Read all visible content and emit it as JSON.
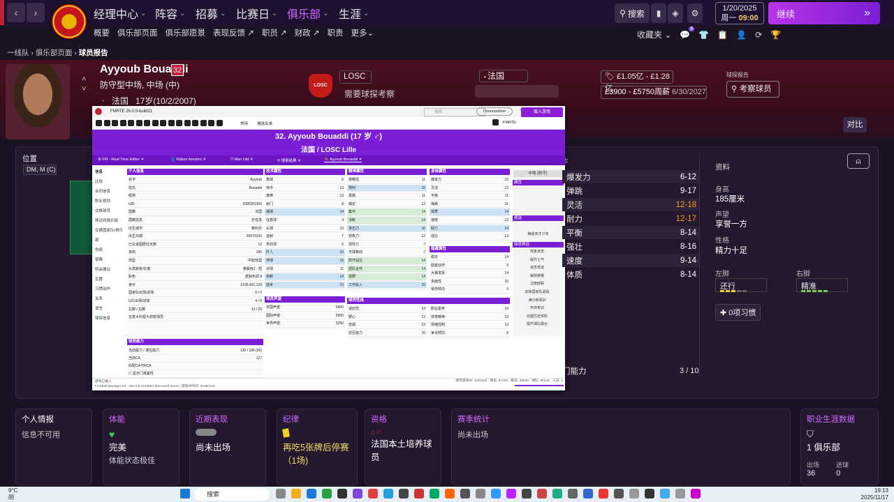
{
  "nav": {
    "main": [
      "经理中心",
      "阵容",
      "招募",
      "比赛日",
      "俱乐部",
      "生涯"
    ],
    "active_index": 4,
    "sub": [
      "概要",
      "俱乐部页面",
      "俱乐部愿景",
      "表现反馈",
      "职员",
      "财政",
      "职责",
      "更多"
    ],
    "search": "搜索",
    "date": "1/20/2025",
    "weekday": "周一",
    "time": "09:00",
    "continue": "继续",
    "favorites": "收藏夹",
    "badge_count": "5"
  },
  "breadcrumb": {
    "a": "一线队",
    "b": "俱乐部页面",
    "c": "球员报告"
  },
  "player": {
    "name": "Ayyoub Bouaddi",
    "number": "32",
    "position": "防守型中场, 中场 (中)",
    "nation": "法国",
    "age": "17岁(10/2/2007)",
    "club": "LOSC",
    "club_crest_text": "LOSC",
    "scout_needed": "需要球探考察",
    "nation2": "法国",
    "value": "£1.05亿 - £1.28亿",
    "wage": "£3900 - £5750周薪",
    "contract": "6/30/2027",
    "scout_report_label": "球探报告",
    "scout_button": "考察球员",
    "compare": "对比"
  },
  "panel": {
    "position_label": "位置",
    "position_value": "DM, M (C)",
    "attributes": [
      {
        "name": "爆发力",
        "value": "6-12",
        "color": "#ffffff"
      },
      {
        "name": "弹跳",
        "value": "9-17",
        "color": "#ffffff"
      },
      {
        "name": "灵活",
        "value": "12-18",
        "color": "#f4a020"
      },
      {
        "name": "耐力",
        "value": "12-17",
        "color": "#f4a020"
      },
      {
        "name": "平衡",
        "value": "8-14",
        "color": "#ffffff"
      },
      {
        "name": "强壮",
        "value": "8-16",
        "color": "#ffffff"
      },
      {
        "name": "速度",
        "value": "9-14",
        "color": "#ffffff"
      },
      {
        "name": "体质",
        "value": "8-14",
        "color": "#ffffff"
      }
    ],
    "gk_label": "门能力",
    "gk_value": "3 / 10",
    "info_title": "资料",
    "height_label": "身高",
    "height": "185厘米",
    "rep_label": "声望",
    "rep": "享誉一方",
    "personality_label": "性格",
    "personality": "精力十足",
    "left_foot_label": "左脚",
    "left_foot": "还行",
    "right_foot_label": "右脚",
    "right_foot": "精准",
    "habits": "0项习惯"
  },
  "cards": {
    "intel_title": "个人情报",
    "intel_text": "信息不可用",
    "fitness_title": "体能",
    "fitness_big": "完美",
    "fitness_sub": "体能状态极佳",
    "form_title": "近期表现",
    "form_big": "尚未出场",
    "discipline_title": "纪律",
    "discipline_big": "再吃5张牌后停赛（1场)",
    "qual_title": "资格",
    "qual_big": "法国本土培养球员",
    "season_title": "赛季统计",
    "season_big": "尚未出场",
    "career_title": "职业生涯数据",
    "career_big": "1 俱乐部",
    "apps_label": "出场",
    "apps": "36",
    "goals_label": "进球",
    "goals": "0"
  },
  "fmrte": {
    "title": "FMRTE 26.0.5-build21",
    "user": "Oooooooliver",
    "search_ph": "搜索...",
    "brand": "FMRTE",
    "load": "载入游戏",
    "tb1": "常用",
    "tb2": "搜选名单",
    "header_name": "32. Ayyoub Bouaddi (17 岁 ♂)",
    "header_club": "法国 / LOSC Lille",
    "tabs": [
      "FM - Real Time Editor",
      "Rúben Amorim",
      "Man Utd",
      "搜索结果",
      "Ayyoub Bouaddi"
    ],
    "left_menu": [
      "信息",
      "比较",
      "合同信息",
      "职业规划",
      "交换球员",
      "移动到俱乐部",
      "交换国家队/俱乐部",
      "伤病",
      "禁赛",
      "转会建议",
      "位置",
      "习惯动作",
      "关系",
      "语言",
      "球探信息"
    ],
    "personal_title": "个人信息",
    "personal": [
      [
        "名字",
        "Ayyoub"
      ],
      [
        "姓氏",
        "Bouaddi"
      ],
      [
        "昵称",
        ""
      ],
      [
        "UID",
        "2000381365"
      ],
      [
        "国籍",
        "法国"
      ],
      [
        "国籍信息",
        "无信息"
      ],
      [
        "出生城市",
        "奥利尔"
      ],
      [
        "出生日期",
        "2007/10/2"
      ],
      [
        "已在该国居住天数",
        "12"
      ],
      [
        "身高",
        "185"
      ],
      [
        "体型",
        "中胚体型"
      ],
      [
        "头发颜色/长度",
        "卷曲色2 · 短"
      ],
      [
        "肤色",
        "皮肤色调 8"
      ],
      [
        "身价",
        "£105,491,128"
      ],
      [
        "国家队出场/进球",
        "0 / 0"
      ],
      [
        "U21出场/进球",
        "4 / 0"
      ],
      [
        "左脚 / 右脚",
        "10 / 20"
      ],
      [
        "在意大利视为非欧球员",
        ""
      ]
    ],
    "ability_title": "球员能力",
    "ability_rows": [
      [
        "当前能力 / 潜在能力",
        "130 / 186 (56)"
      ],
      [
        "当前CA",
        "127"
      ],
      [
        "匹配CA与RCA",
        ""
      ]
    ],
    "show_gk": "显示门将属性",
    "tech_title": "技术属性",
    "tech": [
      [
        "角球",
        "5"
      ],
      [
        "传中",
        "13"
      ],
      [
        "盘带",
        "13"
      ],
      [
        "射门",
        "8"
      ],
      [
        "接球",
        "14"
      ],
      [
        "任意球",
        "4"
      ],
      [
        "头球",
        "10"
      ],
      [
        "远射",
        "7"
      ],
      [
        "界外球",
        "6"
      ],
      [
        "盯人",
        "15"
      ],
      [
        "传球",
        "15"
      ],
      [
        "点球",
        "11"
      ],
      [
        "抢断",
        "14"
      ],
      [
        "技术",
        "15"
      ]
    ],
    "rep_title": "球员声望",
    "rep_rows": [
      [
        "本国声望",
        "6500"
      ],
      [
        "国际声望",
        "6500"
      ],
      [
        "世界声望",
        "5250"
      ]
    ],
    "mental_title": "精神属性",
    "mental": [
      [
        "侵略性",
        "11"
      ],
      [
        "预判",
        "15"
      ],
      [
        "勇敢",
        "11"
      ],
      [
        "镇定",
        "12"
      ],
      [
        "集中",
        "14"
      ],
      [
        "决断",
        "14"
      ],
      [
        "意志力",
        "16"
      ],
      [
        "想象力",
        "12"
      ],
      [
        "领导力",
        "7"
      ],
      [
        "无球跑动",
        "7"
      ],
      [
        "防守站位",
        "14"
      ],
      [
        "团队合作",
        "14"
      ],
      [
        "视野",
        "14"
      ],
      [
        "工作投入",
        "15"
      ]
    ],
    "pers_title": "球员性格",
    "pers": [
      [
        "适应性",
        "13"
      ],
      [
        "野心",
        "13"
      ],
      [
        "忠诚",
        "13"
      ],
      [
        "抗压能力",
        "16"
      ]
    ],
    "pers2": [
      [
        "职业素养",
        "15"
      ],
      [
        "体育精神",
        "13"
      ],
      [
        "情绪控制",
        "13"
      ],
      [
        "争论倾向",
        "8"
      ]
    ],
    "phys_title": "身体属性",
    "phys": [
      [
        "爆发力",
        "12"
      ],
      [
        "灵活",
        "12"
      ],
      [
        "平衡",
        "11"
      ],
      [
        "弹跳",
        "11"
      ],
      [
        "体质",
        "14"
      ],
      [
        "速度",
        "12"
      ],
      [
        "耐力",
        "14"
      ],
      [
        "强壮",
        "13"
      ]
    ],
    "hidden_title": "隐藏属性",
    "hidden": [
      [
        "稳定",
        "14"
      ],
      [
        "肮脏动作",
        "3"
      ],
      [
        "大赛发挥",
        "14"
      ],
      [
        "多面性",
        "10"
      ],
      [
        "受伤倾向",
        "3"
      ]
    ],
    "side_pos": "中场 (防守)",
    "side_attr": "属性",
    "side_pick": "挑选",
    "side_pick_label": "制造天才少年",
    "side_quick": "球员预设",
    "side_buttons": [
      "恢复状态",
      "提升士气",
      "状态低迷",
      "解除禁赛",
      "注册欧联",
      "去除国家队退役",
      "满分新闻训",
      "丰田育训",
      "创建历史资料",
      "提升球队融合"
    ],
    "status_l1": "游戏已载入",
    "status_l2": "Football Manager 26 - v26.0.5.2234654 (Microsoft store) / 游戏中时间: 2025/1/20",
    "status_r": "保存游戏ID: 1191829 · 球员: 87325 · 职员: 38848 · 球队: 80143 · 人员: 1"
  },
  "taskbar": {
    "weather_temp": "9°C",
    "weather": "阴",
    "search": "搜索",
    "time": "19:13",
    "date": "2025/11/17"
  }
}
